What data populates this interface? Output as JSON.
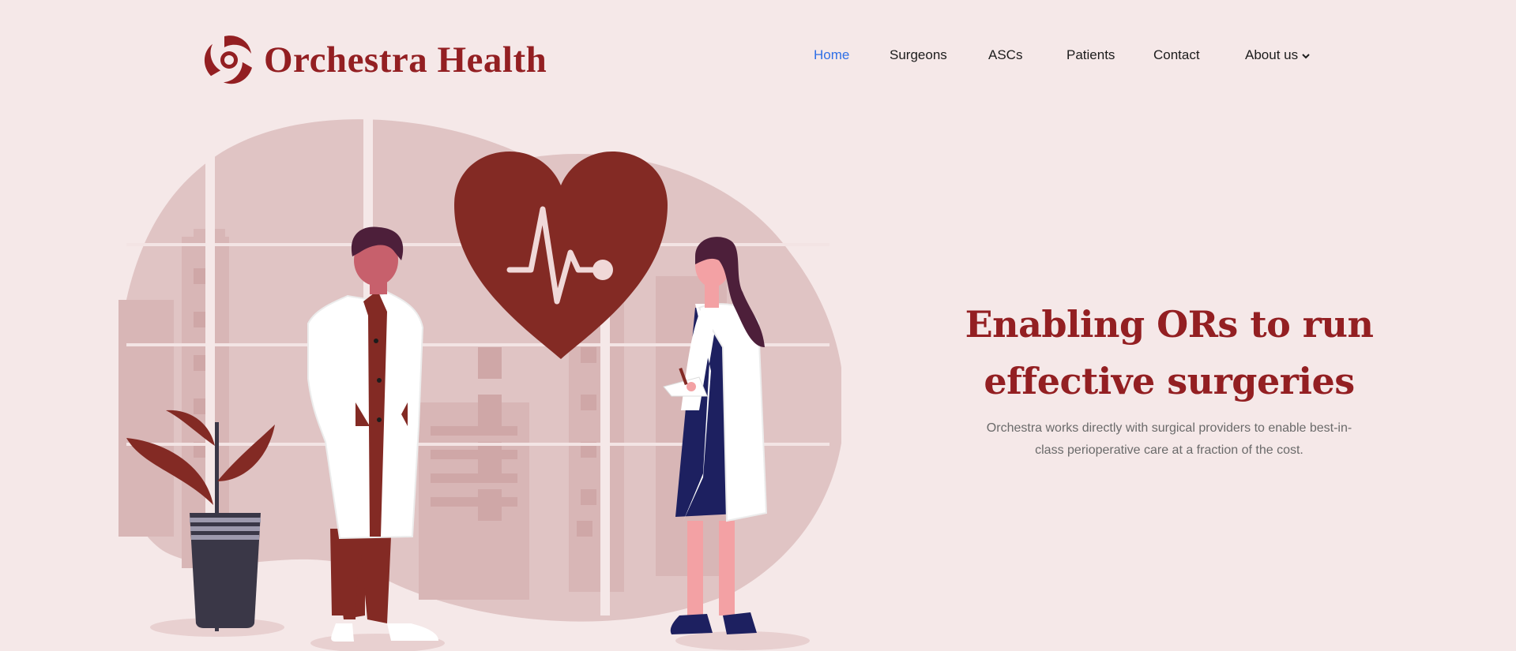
{
  "brand": {
    "name": "Orchestra Health",
    "color": "#931f22"
  },
  "nav": {
    "items": [
      {
        "label": "Home",
        "active": true
      },
      {
        "label": "Surgeons"
      },
      {
        "label": "ASCs"
      },
      {
        "label": "Patients"
      },
      {
        "label": "Contact"
      },
      {
        "label": "About us",
        "icon": "chevron-down-icon"
      }
    ],
    "active_color": "#2f6fe6"
  },
  "hero": {
    "title_line1": "Enabling ORs to run",
    "title_line2": "effective surgeries",
    "subtitle": "Orchestra works directly with surgical providers to enable best-in-class perioperative care at a fraction of the cost."
  },
  "illustration": {
    "icon": "heart-pulse-icon",
    "subjects": [
      "male doctor",
      "female doctor",
      "potted plant",
      "city window background"
    ]
  }
}
